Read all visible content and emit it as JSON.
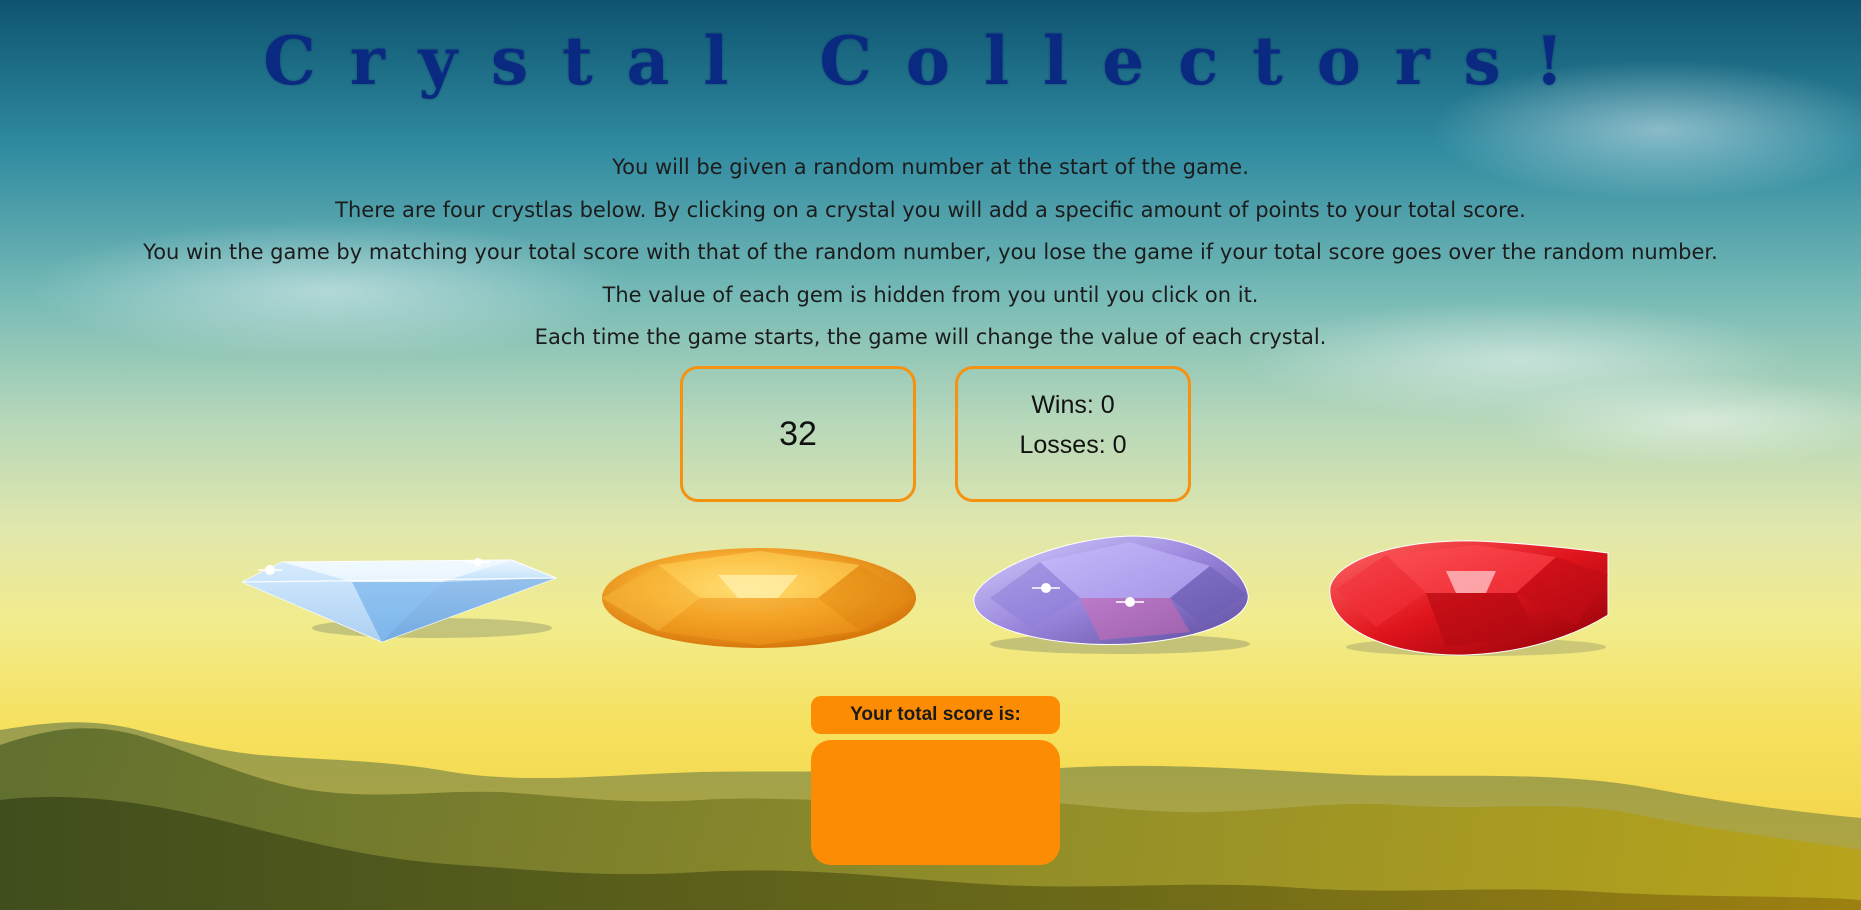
{
  "title": "Crystal Collectors!",
  "instructions": [
    "You will be given a random number at the start of the game.",
    "There are four crystlas below. By clicking on a crystal you will add a specific amount of points to your total score.",
    "You win the game by matching your total score with that of the random number, you lose the game if your total score goes over the random number.",
    "The value of each gem is hidden from you until you click on it.",
    "Each time the game starts, the game will change the value of each crystal."
  ],
  "target_number": "32",
  "record": {
    "wins_text": "Wins: 0",
    "losses_text": "Losses: 0"
  },
  "crystals": [
    {
      "name": "diamond-crystal",
      "icon": "blue-diamond-icon",
      "color": "#bfe0ff"
    },
    {
      "name": "amber-crystal",
      "icon": "orange-gem-icon",
      "color": "#f5a623"
    },
    {
      "name": "amethyst-crystal",
      "icon": "purple-gem-icon",
      "color": "#a08ce0"
    },
    {
      "name": "ruby-crystal",
      "icon": "red-gem-icon",
      "color": "#e0141c"
    }
  ],
  "score": {
    "label": "Your total score is:",
    "value": ""
  },
  "colors": {
    "title": "#0a2a82",
    "box_border": "#f59210",
    "score_background": "#fb8c04"
  }
}
